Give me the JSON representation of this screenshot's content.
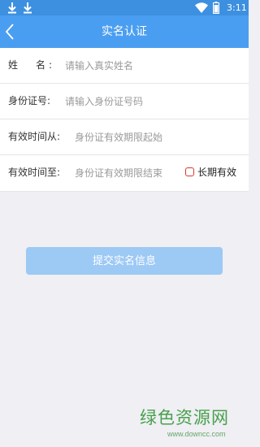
{
  "status_bar": {
    "time": "3:11",
    "icons": [
      "download-icon",
      "download-icon",
      "wifi-icon",
      "battery-icon"
    ]
  },
  "nav": {
    "title": "实名认证",
    "back_icon": "chevron-left-icon"
  },
  "form": {
    "name": {
      "label": "姓名",
      "placeholder": "请输入真实姓名"
    },
    "id_number": {
      "label": "身份证号:",
      "placeholder": "请输入身份证号码"
    },
    "valid_from": {
      "label": "有效时间从:",
      "placeholder": "身份证有效期限起始"
    },
    "valid_to": {
      "label": "有效时间至:",
      "placeholder": "身份证有效期限结束"
    },
    "long_term": {
      "label": "长期有效",
      "checked": false
    }
  },
  "submit": {
    "label": "提交实名信息"
  },
  "watermark": {
    "title": "绿色资源网",
    "url": "www.downcc.com"
  },
  "colors": {
    "status_bar": "#3d90e0",
    "nav_bar": "#4a9ef1",
    "submit_button": "#9dc9f5",
    "checkbox_border": "#d9362b",
    "background": "#efeff4"
  }
}
